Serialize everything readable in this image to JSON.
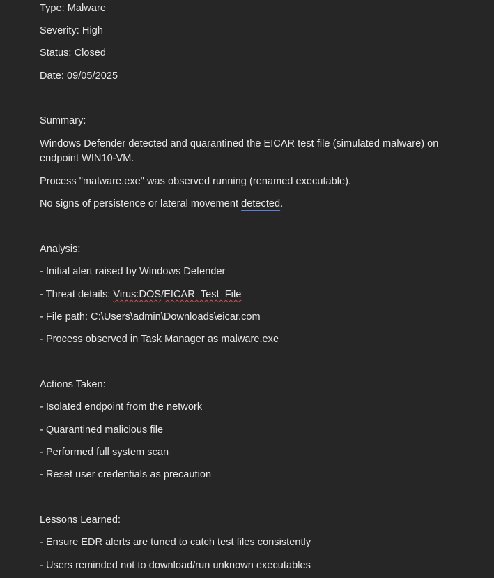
{
  "header": {
    "type": "Type: Malware",
    "severity": "Severity: High",
    "status": "Status: Closed",
    "date": "Date: 09/05/2025"
  },
  "summary": {
    "heading": "Summary:",
    "p1": "Windows Defender detected and quarantined the EICAR test file (simulated malware) on endpoint WIN10-VM.",
    "p2": "Process \"malware.exe\" was observed running (renamed executable).",
    "p3_before": "No signs of persistence or lateral movement ",
    "p3_flagged": "detected",
    "p3_after": "."
  },
  "analysis": {
    "heading": "Analysis:",
    "item1": "- Initial alert raised by Windows Defender",
    "item2_before": "- Threat details: ",
    "item2_flag1": "Virus:DOS",
    "item2_mid": "/",
    "item2_flag2": "EICAR_Test_File",
    "item3": "- File path: C:\\Users\\admin\\Downloads\\eicar.com",
    "item4": "- Process observed in Task Manager as malware.exe"
  },
  "actions": {
    "heading": "Actions Taken:",
    "items": [
      "- Isolated endpoint from the network",
      "- Quarantined malicious file",
      "- Performed full system scan",
      "- Reset user credentials as precaution"
    ]
  },
  "lessons": {
    "heading": "Lessons Learned:",
    "items": [
      "- Ensure EDR alerts are tuned to catch test files consistently",
      "- Users reminded not to download/run unknown executables"
    ]
  },
  "colors": {
    "background": "#262626",
    "text": "#e8e8e8",
    "spellcheck_underline": "#d9534f",
    "grammar_underline": "#5b7fd8"
  }
}
